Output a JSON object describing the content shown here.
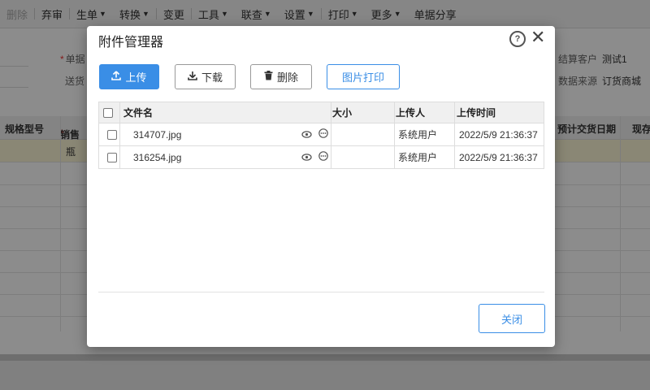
{
  "toolbar": {
    "items": [
      {
        "label": "删除",
        "dropdown": false,
        "disabled": true
      },
      {
        "label": "弃审",
        "dropdown": false
      },
      {
        "label": "生单",
        "dropdown": true
      },
      {
        "label": "转换",
        "dropdown": true
      },
      {
        "label": "变更",
        "dropdown": false
      },
      {
        "label": "工具",
        "dropdown": true
      },
      {
        "label": "联查",
        "dropdown": true
      },
      {
        "label": "设置",
        "dropdown": true
      },
      {
        "label": "打印",
        "dropdown": true
      },
      {
        "label": "更多",
        "dropdown": true
      },
      {
        "label": "单据分享",
        "dropdown": false
      }
    ]
  },
  "form": {
    "doc_label": "单据",
    "ship_label": "送货",
    "settle_customer_label": "结算客户",
    "settle_customer_value": "测试1",
    "data_source_label": "数据来源",
    "data_source_value": "订货商城"
  },
  "grid": {
    "columns": [
      "规格型号",
      "销售",
      "预计交货日期",
      "现存"
    ],
    "first_row_unit": "瓶"
  },
  "modal": {
    "title": "附件管理器",
    "help_glyph": "?",
    "close_glyph": "✕",
    "buttons": {
      "upload": "上传",
      "download": "下载",
      "delete": "删除",
      "print_image": "图片打印"
    },
    "table": {
      "headers": {
        "file_name": "文件名",
        "size": "大小",
        "uploader": "上传人",
        "upload_time": "上传时间"
      },
      "rows": [
        {
          "file_name": "314707.jpg",
          "size": "",
          "uploader": "系统用户",
          "upload_time": "2022/5/9 21:36:37"
        },
        {
          "file_name": "316254.jpg",
          "size": "",
          "uploader": "系统用户",
          "upload_time": "2022/5/9 21:36:37"
        }
      ]
    },
    "close_button": "关闭"
  },
  "icons": {
    "upload": "upload-icon",
    "download": "download-icon",
    "delete": "trash-icon",
    "preview": "eye-icon",
    "more": "more-icon"
  },
  "colors": {
    "accent": "#3a8ee6",
    "required": "#e33333",
    "row_highlight": "#fcf6d6"
  }
}
